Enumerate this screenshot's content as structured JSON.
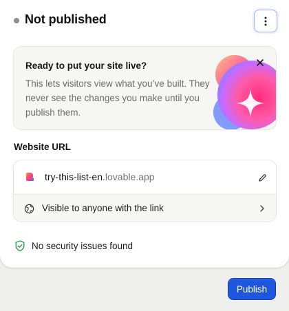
{
  "header": {
    "status_title": "Not published",
    "more_icon": "more-vertical-icon"
  },
  "promo": {
    "title": "Ready to put your site live?",
    "text": "This lets visitors view what you’ve built. They never see the changes you make until you publish them.",
    "close_icon": "close-icon"
  },
  "website_url": {
    "label": "Website URL",
    "subdomain": "try-this-list-en",
    "domain": ".lovable.app",
    "edit_icon": "pencil-icon",
    "visibility_text": "Visible to anyone with the link",
    "visibility_icon": "globe-icon",
    "chevron_icon": "chevron-right-icon"
  },
  "security": {
    "text": "No security issues found",
    "icon": "shield-check-icon",
    "color": "#2f9e44"
  },
  "footer": {
    "publish_label": "Publish",
    "accent": "#1f56e0"
  }
}
